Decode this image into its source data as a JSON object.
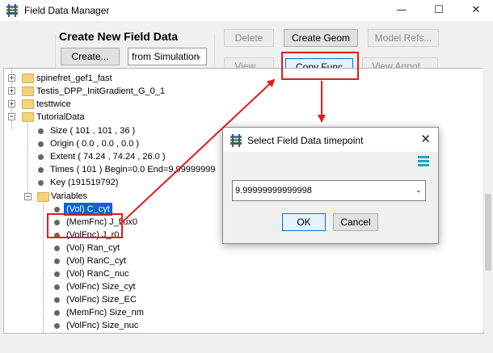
{
  "window": {
    "title": "Field Data Manager",
    "minimize": "—",
    "maximize": "☐",
    "close": "✕"
  },
  "create_group": {
    "title": "Create New Field Data",
    "create_button": "Create...",
    "source_value": "from Simulation"
  },
  "toolbar": {
    "delete": "Delete",
    "create_geom": "Create Geom",
    "model_refs": "Model Refs...",
    "view": "View...",
    "copy_func": "Copy Func",
    "view_annot": "View Annot..."
  },
  "tree": {
    "items": [
      "spinefret_gef1_fast",
      "Testis_DPP_InitGradient_G_0_1",
      "testtwice",
      "TutorialData"
    ],
    "tutorial_props": [
      "Size ( 101 , 101 , 36 )",
      "Origin ( 0.0 , 0.0 , 0.0 )",
      "Extent ( 74.24 , 74.24 , 26.0 )",
      "Times ( 101 )  Begin=0.0  End=9.99999999",
      "Key (191519792)"
    ],
    "variables_label": "Variables",
    "variables": [
      "(Vol) C_cyt",
      "(MemFnc) J_flux0",
      "(VolFnc) J_r0",
      "(Vol) Ran_cyt",
      "(Vol) RanC_cyt",
      "(Vol) RanC_nuc",
      "(VolFnc) Size_cyt",
      "(VolFnc) Size_EC",
      "(MemFnc) Size_nm",
      "(VolFnc) Size_nuc"
    ]
  },
  "dialog": {
    "title": "Select Field Data timepoint",
    "selected_value": "9.99999999999998",
    "ok": "OK",
    "cancel": "Cancel"
  },
  "colors": {
    "highlight": "#e01b1b",
    "selection": "#0a63d6",
    "accent": "#16a7c4"
  }
}
